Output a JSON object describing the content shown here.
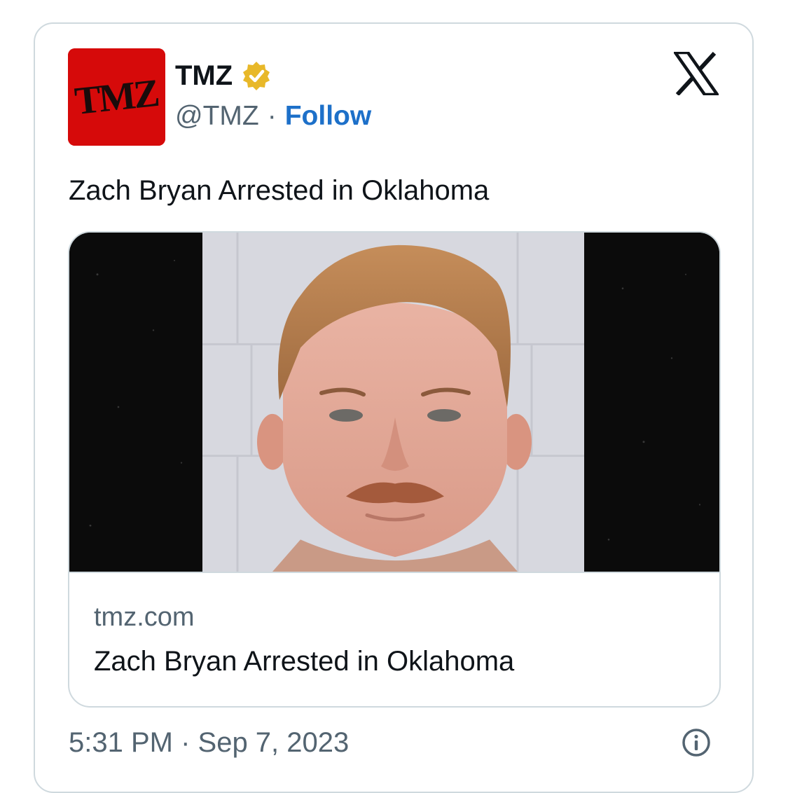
{
  "author": {
    "avatar_text": "TMZ",
    "display_name": "TMZ",
    "handle": "@TMZ",
    "separator": "·",
    "follow_label": "Follow",
    "verified_icon": "verified-badge-gold-icon"
  },
  "platform_icon": "x-logo-icon",
  "tweet": {
    "text": "Zach Bryan Arrested in Oklahoma"
  },
  "link_card": {
    "image_icon": "mugshot-photo",
    "domain": "tmz.com",
    "title": "Zach Bryan Arrested in Oklahoma"
  },
  "footer": {
    "timestamp": "5:31 PM · Sep 7, 2023",
    "info_icon": "info-icon"
  },
  "colors": {
    "brand_red": "#d60a0a",
    "link_blue": "#1d70c9",
    "muted_text": "#536471",
    "border": "#cfd9de",
    "verified_gold": "#e8b829"
  }
}
